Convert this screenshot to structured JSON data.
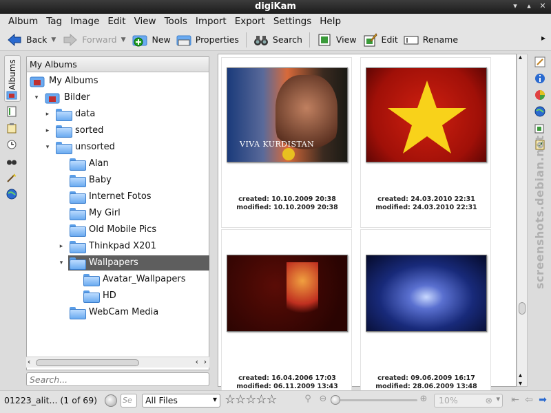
{
  "window": {
    "title": "digiKam"
  },
  "menubar": [
    "Album",
    "Tag",
    "Image",
    "Edit",
    "View",
    "Tools",
    "Import",
    "Export",
    "Settings",
    "Help"
  ],
  "toolbar": {
    "back": "Back",
    "forward": "Forward",
    "new": "New",
    "properties": "Properties",
    "search": "Search",
    "view": "View",
    "edit": "Edit",
    "rename": "Rename"
  },
  "left_tab": {
    "label": "Albums"
  },
  "tree": {
    "header": "My Albums",
    "items": [
      "My Albums",
      "Bilder",
      "data",
      "sorted",
      "unsorted",
      "Alan",
      "Baby",
      "Internet Fotos",
      "My Girl",
      "Old Mobile Pics",
      "Thinkpad X201",
      "Wallpapers",
      "Avatar_Wallpapers",
      "HD",
      "WebCam Media"
    ],
    "selected": "Wallpapers",
    "search_placeholder": "Search..."
  },
  "thumbnails": [
    {
      "created": "created: 10.10.2009 20:38",
      "modified": "modified: 10.10.2009 20:38",
      "overlay": "VIVA KURDISTAN"
    },
    {
      "created": "created: 24.03.2010 22:31",
      "modified": "modified: 24.03.2010 22:31"
    },
    {
      "created": "created: 16.04.2006 17:03",
      "modified": "modified: 06.11.2009 13:43"
    },
    {
      "created": "created: 09.06.2009 16:17",
      "modified": "modified: 28.06.2009 13:48"
    }
  ],
  "watermark": "screenshots.debian.net",
  "statusbar": {
    "info": "01223_alit... (1 of 69)",
    "search_placeholder": "Se",
    "filter_value": "All Files",
    "rating_stars": 0,
    "zoom_value": "10%"
  },
  "colors": {
    "selection": "#5e5e5e",
    "folder": "#6aaaf0",
    "titlebar": "#2a2a2a"
  }
}
